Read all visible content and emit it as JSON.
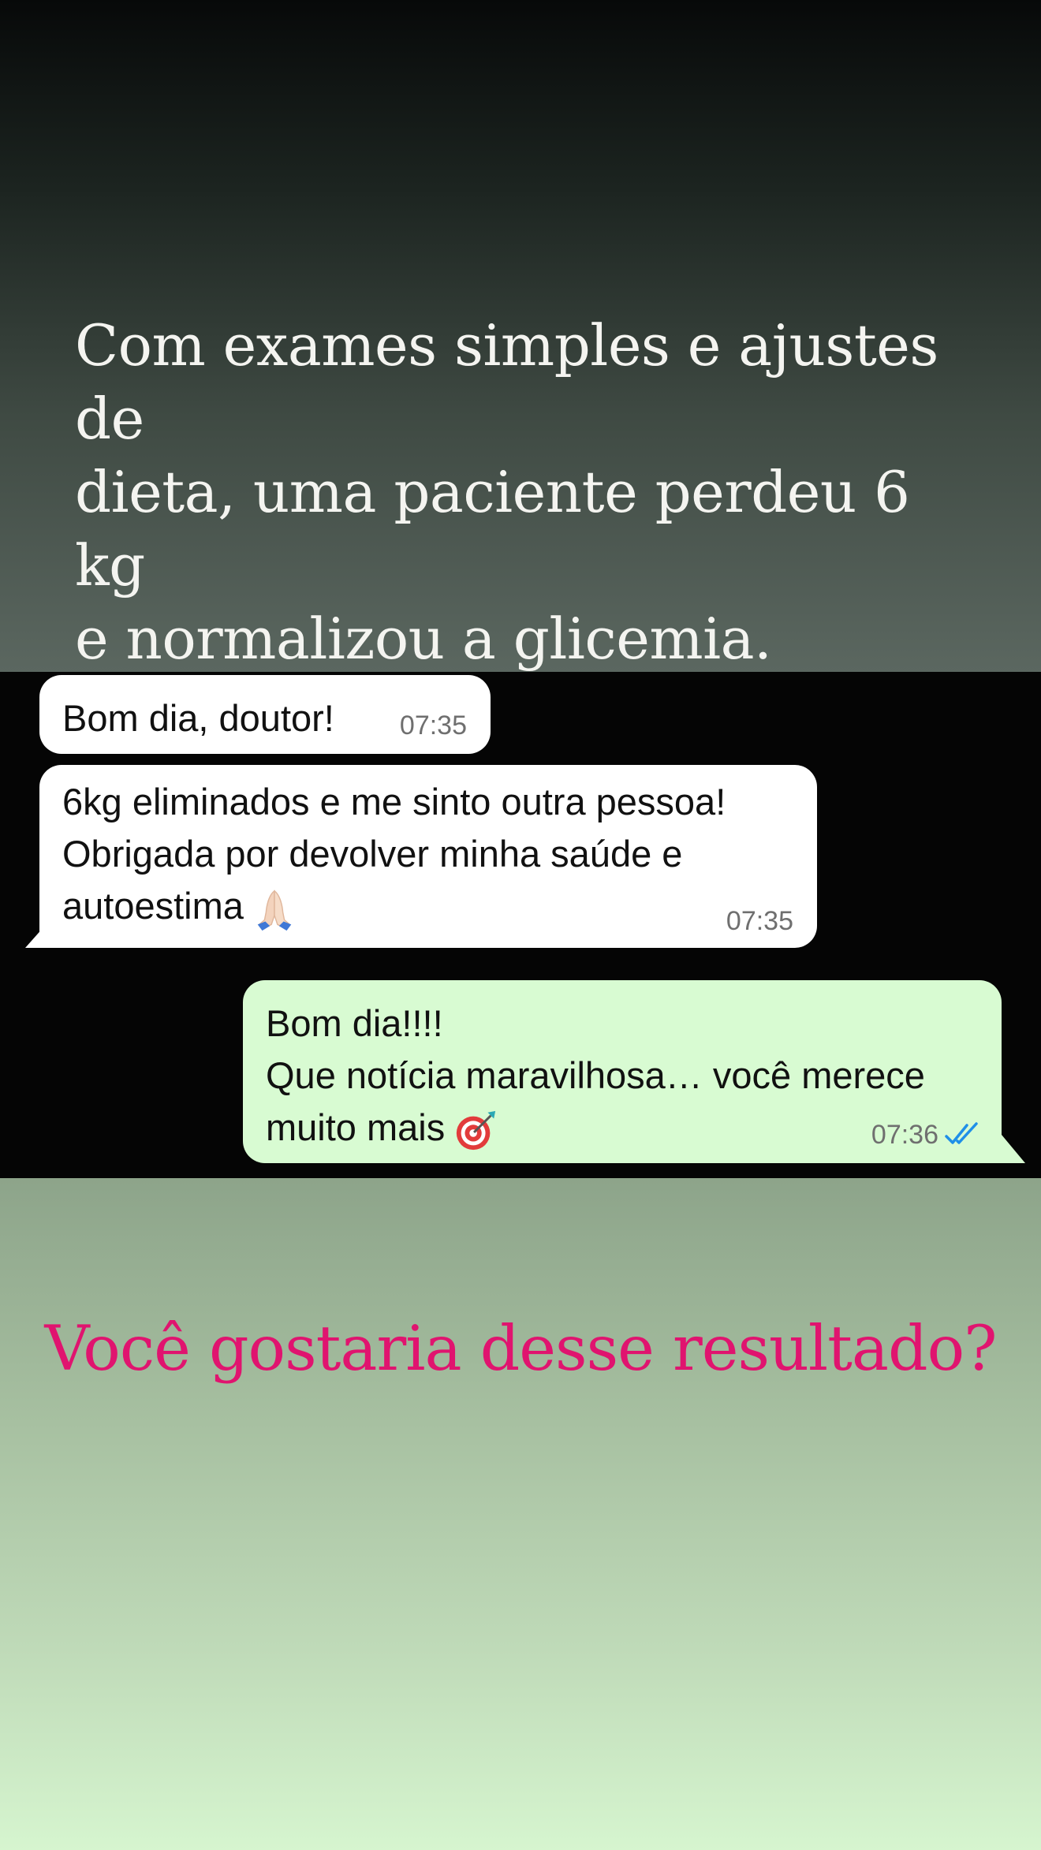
{
  "story": {
    "headline": "Com exames simples e ajustes de\ndieta, uma paciente perdeu 6 kg\ne normalizou a glicemia.",
    "question": "Você gostaria desse resultado?",
    "question_color": "#e0146f"
  },
  "chat": {
    "messages": [
      {
        "direction": "incoming",
        "text": "Bom dia, doutor!",
        "time": "07:35"
      },
      {
        "direction": "incoming",
        "text": "6kg eliminados e me sinto outra pessoa!\nObrigada por devolver minha saúde e\nautoestima",
        "emoji": "folded-hands-icon",
        "time": "07:35"
      },
      {
        "direction": "outgoing",
        "text": "Bom dia!!!!\nQue notícia maravilhosa… você merece\nmuito mais",
        "emoji": "direct-hit-icon",
        "time": "07:36",
        "status": "read-double-check-icon"
      }
    ],
    "colors": {
      "incoming_bubble": "#ffffff",
      "outgoing_bubble": "#d8fbd2",
      "read_ticks": "#1f8fe8"
    }
  }
}
